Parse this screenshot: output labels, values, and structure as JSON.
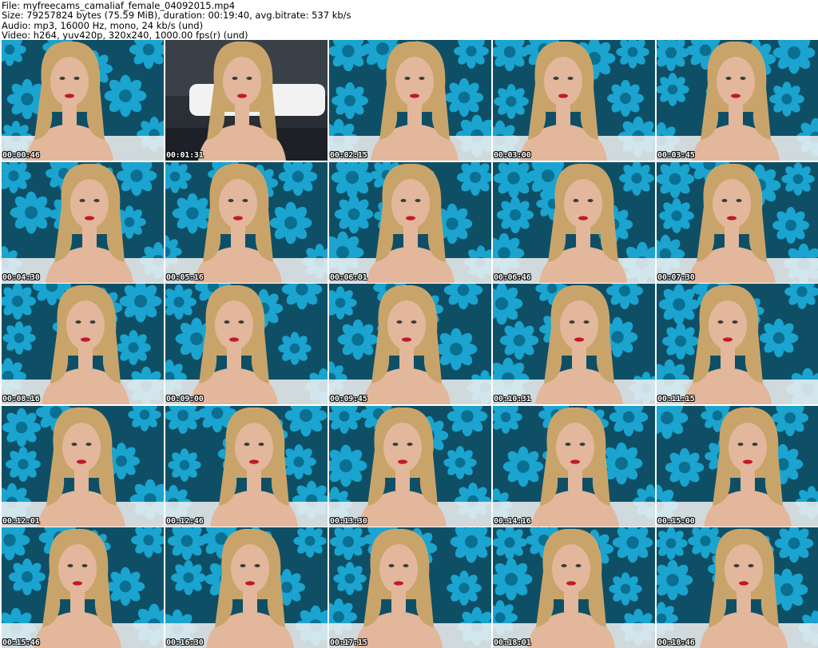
{
  "header": {
    "file_line": "File: myfreecams_camaliaf_female_04092015.mp4",
    "size_line": "Size: 79257824 bytes (75.59 MiB), duration: 00:19:40, avg.bitrate: 537 kb/s",
    "audio_line": "Audio: mp3, 16000 Hz, mono, 24 kb/s (und)",
    "video_line": "Video: h264, yuv420p, 320x240, 1000.00 fps(r) (und)"
  },
  "colors": {
    "wallpaper_bg": "#0e4f66",
    "flower": "#1aa4cf",
    "flower_dark": "#0a6f91",
    "pillow": "#f2f2f2",
    "skin": "#e2b79b",
    "hair": "#c9a46a",
    "lips": "#c0192e",
    "timestamp_text": "#ffffff"
  },
  "thumbnails": [
    {
      "time": "00:00:46",
      "scene": "wallpaper",
      "icon": "video-frame"
    },
    {
      "time": "00:01:31",
      "scene": "bed",
      "icon": "video-frame"
    },
    {
      "time": "00:02:15",
      "scene": "wallpaper",
      "icon": "video-frame"
    },
    {
      "time": "00:03:00",
      "scene": "wallpaper",
      "icon": "video-frame"
    },
    {
      "time": "00:03:45",
      "scene": "wallpaper",
      "icon": "video-frame"
    },
    {
      "time": "00:04:30",
      "scene": "wallpaper",
      "icon": "video-frame"
    },
    {
      "time": "00:05:16",
      "scene": "wallpaper",
      "icon": "video-frame"
    },
    {
      "time": "00:06:01",
      "scene": "wallpaper",
      "icon": "video-frame"
    },
    {
      "time": "00:06:46",
      "scene": "wallpaper",
      "icon": "video-frame"
    },
    {
      "time": "00:07:30",
      "scene": "wallpaper",
      "icon": "video-frame"
    },
    {
      "time": "00:08:16",
      "scene": "wallpaper",
      "icon": "video-frame"
    },
    {
      "time": "00:09:00",
      "scene": "wallpaper",
      "icon": "video-frame"
    },
    {
      "time": "00:09:45",
      "scene": "wallpaper",
      "icon": "video-frame"
    },
    {
      "time": "00:10:31",
      "scene": "wallpaper",
      "icon": "video-frame"
    },
    {
      "time": "00:11:15",
      "scene": "wallpaper",
      "icon": "video-frame"
    },
    {
      "time": "00:12:01",
      "scene": "wallpaper",
      "icon": "video-frame"
    },
    {
      "time": "00:12:46",
      "scene": "wallpaper",
      "icon": "video-frame"
    },
    {
      "time": "00:13:30",
      "scene": "wallpaper",
      "icon": "video-frame"
    },
    {
      "time": "00:14:16",
      "scene": "wallpaper",
      "icon": "video-frame"
    },
    {
      "time": "00:15:00",
      "scene": "wallpaper",
      "icon": "video-frame"
    },
    {
      "time": "00:15:46",
      "scene": "wallpaper",
      "icon": "video-frame"
    },
    {
      "time": "00:16:30",
      "scene": "wallpaper",
      "icon": "video-frame"
    },
    {
      "time": "00:17:15",
      "scene": "wallpaper",
      "icon": "video-frame"
    },
    {
      "time": "00:18:01",
      "scene": "wallpaper",
      "icon": "video-frame"
    },
    {
      "time": "00:18:46",
      "scene": "wallpaper",
      "icon": "video-frame"
    }
  ]
}
